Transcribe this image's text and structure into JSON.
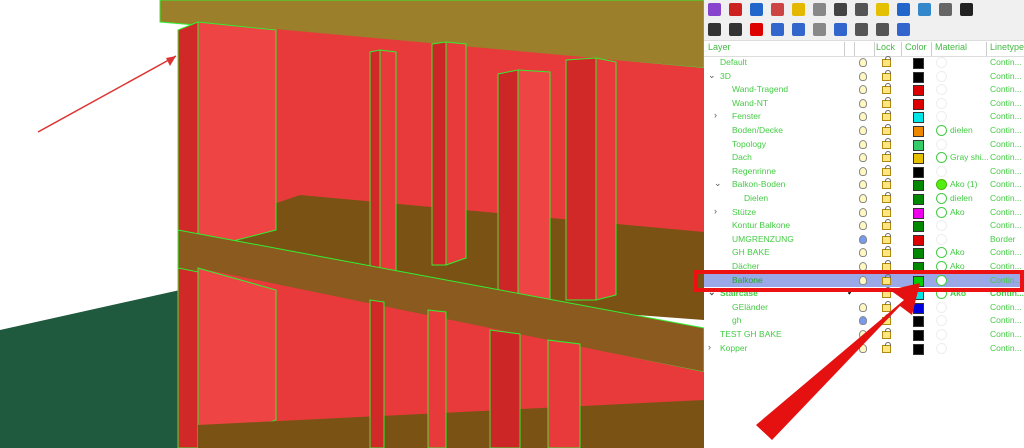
{
  "panel": {
    "headers": {
      "layer": "Layer",
      "lock": "Lock",
      "color": "Color",
      "material": "Material",
      "linetype": "Linetype"
    },
    "rows": [
      {
        "name": "Default",
        "indent": 0,
        "exp": "",
        "color": "#000000",
        "mat": "none",
        "matname": "",
        "lt": "Contin..."
      },
      {
        "name": "3D",
        "indent": 0,
        "exp": "v",
        "color": "#000000",
        "mat": "none",
        "matname": "",
        "lt": "Contin..."
      },
      {
        "name": "Wand-Tragend",
        "indent": 2,
        "exp": "",
        "color": "#dd0000",
        "mat": "none",
        "matname": "",
        "lt": "Contin..."
      },
      {
        "name": "Wand-NT",
        "indent": 2,
        "exp": "",
        "color": "#dd0000",
        "mat": "none",
        "matname": "",
        "lt": "Contin..."
      },
      {
        "name": "Fenster",
        "indent": 2,
        "exp": ">",
        "color": "#00e5e5",
        "mat": "none",
        "matname": "",
        "lt": "Contin..."
      },
      {
        "name": "Boden/Decke",
        "indent": 2,
        "exp": "",
        "color": "#ee8800",
        "mat": "ring",
        "matname": "dielen",
        "lt": "Contin..."
      },
      {
        "name": "Topology",
        "indent": 2,
        "exp": "",
        "color": "#33cc66",
        "mat": "none",
        "matname": "",
        "lt": "Contin..."
      },
      {
        "name": "Dach",
        "indent": 2,
        "exp": "",
        "color": "#e5c000",
        "mat": "ring",
        "matname": "Gray shi...",
        "lt": "Contin..."
      },
      {
        "name": "Regenrinne",
        "indent": 2,
        "exp": "",
        "color": "#000000",
        "mat": "none",
        "matname": "",
        "lt": "Contin..."
      },
      {
        "name": "Balkon-Boden",
        "indent": 2,
        "exp": "v",
        "color": "#008800",
        "mat": "fill",
        "matname": "Ako (1)",
        "lt": "Contin..."
      },
      {
        "name": "Dielen",
        "indent": 4,
        "exp": "",
        "color": "#008800",
        "mat": "ring",
        "matname": "dielen",
        "lt": "Contin..."
      },
      {
        "name": "Stütze",
        "indent": 2,
        "exp": ">",
        "color": "#ee00ee",
        "mat": "ring",
        "matname": "Ako",
        "lt": "Contin..."
      },
      {
        "name": "Kontur Balkone",
        "indent": 2,
        "exp": "",
        "color": "#008800",
        "mat": "none",
        "matname": "",
        "lt": "Contin..."
      },
      {
        "name": "UMGRENZUNG",
        "indent": 2,
        "exp": "",
        "color": "#dd0000",
        "mat": "none",
        "matname": "",
        "lt": "Border",
        "bulb": "blue"
      },
      {
        "name": "GH BAKE",
        "indent": 2,
        "exp": "",
        "color": "#008800",
        "mat": "ring",
        "matname": "Ako",
        "lt": "Contin..."
      },
      {
        "name": "Dächer",
        "indent": 2,
        "exp": "",
        "color": "#008800",
        "mat": "ring",
        "matname": "Ako",
        "lt": "Contin..."
      },
      {
        "name": "Balkone",
        "indent": 2,
        "exp": "",
        "color": "#00cc00",
        "mat": "ring",
        "matname": "",
        "lt": "Contin...",
        "sel": true
      },
      {
        "name": "Staircase",
        "indent": 0,
        "exp": "v",
        "color": "#00e5e5",
        "mat": "ring",
        "matname": "Ako",
        "lt": "Contin...",
        "bold": true,
        "check": true
      },
      {
        "name": "GEländer",
        "indent": 2,
        "exp": "",
        "color": "#0000dd",
        "mat": "none",
        "matname": "",
        "lt": "Contin..."
      },
      {
        "name": "gh",
        "indent": 2,
        "exp": "",
        "color": "#000000",
        "mat": "none",
        "matname": "",
        "lt": "Contin...",
        "bulb": "blue"
      },
      {
        "name": "TEST GH BAKE",
        "indent": 0,
        "exp": "",
        "color": "#000000",
        "mat": "none",
        "matname": "",
        "lt": "Contin..."
      },
      {
        "name": "Kopper",
        "indent": 0,
        "exp": ">",
        "color": "#000000",
        "mat": "none",
        "matname": "",
        "lt": "Contin..."
      }
    ]
  },
  "toolbar_icons": [
    {
      "icon": "color-wheel-icon",
      "color": "#8844cc"
    },
    {
      "icon": "layer-icon",
      "color": "#cc2222"
    },
    {
      "icon": "globe-icon",
      "color": "#2266cc"
    },
    {
      "icon": "pencil-icon",
      "color": "#cc4444"
    },
    {
      "icon": "folder-icon",
      "color": "#e5b800"
    },
    {
      "icon": "cylinder-icon",
      "color": "#888888"
    },
    {
      "icon": "palette-icon",
      "color": "#444444"
    },
    {
      "icon": "monitor-icon",
      "color": "#555555"
    },
    {
      "icon": "bulb-icon",
      "color": "#e5c000"
    },
    {
      "icon": "lock-icon",
      "color": "#2266cc"
    },
    {
      "icon": "image-icon",
      "color": "#3388cc"
    },
    {
      "icon": "film-icon",
      "color": "#666666"
    },
    {
      "icon": "checker-icon",
      "color": "#222222"
    }
  ],
  "toolbar2_icons": [
    {
      "icon": "new-layer-icon",
      "color": "#333333"
    },
    {
      "icon": "new-sublayer-icon",
      "color": "#333333"
    },
    {
      "icon": "delete-icon",
      "color": "#dd0000"
    },
    {
      "icon": "move-up-icon",
      "color": "#3366cc"
    },
    {
      "icon": "move-down-icon",
      "color": "#3366cc"
    },
    {
      "icon": "move-left-icon",
      "color": "#888888"
    },
    {
      "icon": "filter-icon",
      "color": "#3366cc"
    },
    {
      "icon": "copy-icon",
      "color": "#555555"
    },
    {
      "icon": "tools-icon",
      "color": "#555555"
    },
    {
      "icon": "help-icon",
      "color": "#3366cc"
    }
  ]
}
